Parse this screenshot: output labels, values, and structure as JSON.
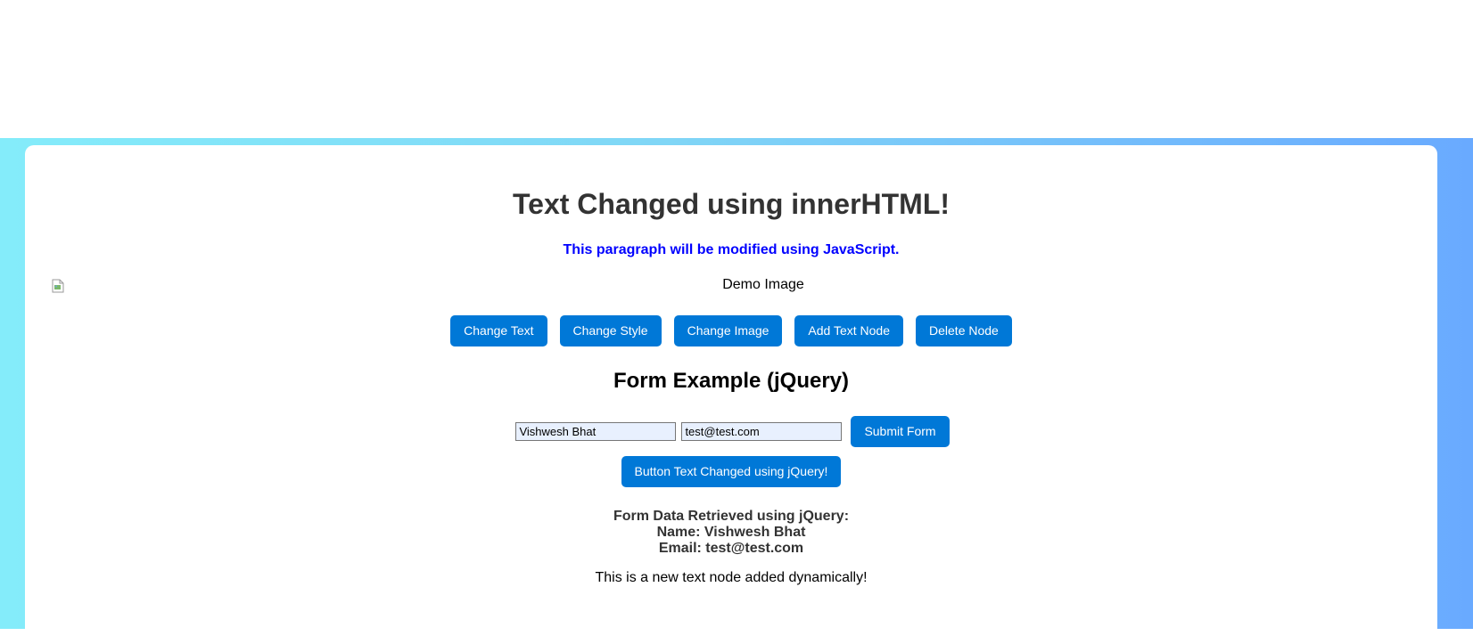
{
  "card": {
    "heading": "Text Changed using innerHTML!",
    "paragraph": "This paragraph will be modified using JavaScript.",
    "image_alt": "Demo Image",
    "buttons": [
      {
        "label": "Change Text"
      },
      {
        "label": "Change Style"
      },
      {
        "label": "Change Image"
      },
      {
        "label": "Add Text Node"
      },
      {
        "label": "Delete Node"
      }
    ]
  },
  "form": {
    "title": "Form Example (jQuery)",
    "name_value": "Vishwesh Bhat",
    "email_value": "test@test.com",
    "submit_label": "Submit Form",
    "jquery_button_label": "Button Text Changed using jQuery!"
  },
  "output": {
    "title": "Form Data Retrieved using jQuery:",
    "name_line": "Name: Vishwesh Bhat",
    "email_line": "Email: test@test.com"
  },
  "new_text_node": "This is a new text node added dynamically!",
  "colors": {
    "button": "#0078d7",
    "paragraph": "#0000ff",
    "heading": "#333333",
    "gradient_start": "#84ecfa",
    "gradient_end": "#69aaff"
  }
}
